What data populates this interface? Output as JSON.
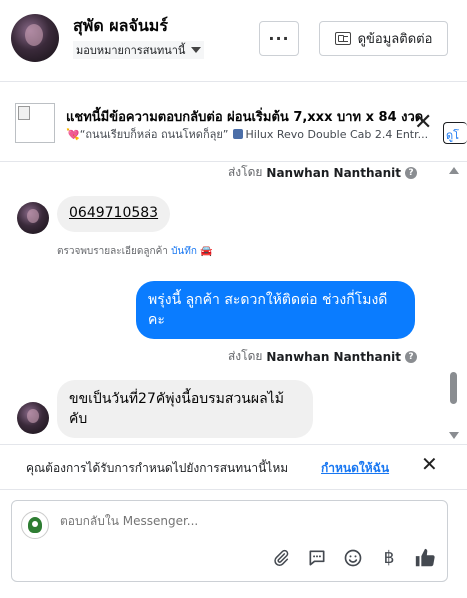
{
  "header": {
    "contact_name": "สุพัด ผลจันมร์",
    "assign_label": "มอบหมายการสนทนานี้",
    "more_label": "···",
    "contact_info_label": "ดูข้อมูลติดต่อ"
  },
  "ad": {
    "title": "แชทนี้มีข้อความตอบกลับต่อ ผ่อนเริ่มต้น 7,xxx บาท x 84 งวด",
    "quote": "“ถนนเรียบก็หล่อ ถนนโหดก็ลุย”",
    "product": "Hilux Revo Double Cab 2.4 Entr...",
    "link_label": "ดูโ"
  },
  "thread": {
    "sent_by_prefix": "ส่งโดย",
    "sent_by_name": "Nanwhan Nanthanit",
    "phone": "0649710583",
    "note_prefix": "ตรวจพบรายละเอียดลูกค้า",
    "note_link": "บันทึก",
    "outgoing": "พรุ่งนี้ ลูกค้า สะดวกให้ติดต่อ ช่วงกี่โมงดีคะ",
    "incoming_last": "ขขเป็นวันที่27คัพุ่งนี้อบรมสวนผลไม้คับ"
  },
  "assign_prompt": {
    "text": "คุณต้องการได้รับการกำหนดไปยังการสนทนานี้ไหม",
    "link": "กำหนดให้ฉัน"
  },
  "composer": {
    "placeholder": "ตอบกลับใน Messenger..."
  },
  "scrollbar": {
    "thumb_position": 0.75
  },
  "colors": {
    "accent": "#1877f2",
    "outgoing_bubble": "#0a7cff",
    "incoming_bubble": "#f0f0f0"
  }
}
